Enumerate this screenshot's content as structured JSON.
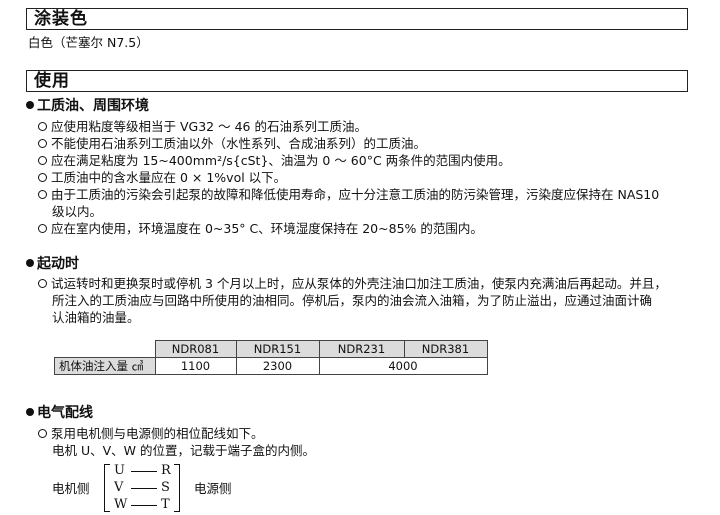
{
  "coating": {
    "heading": "涂装色",
    "text": "白色（芒塞尔 N7.5）"
  },
  "usage": {
    "heading": "使用",
    "oil": {
      "title": "工质油、周围环境",
      "lines": [
        "应使用粘度等级相当于 VG32 ～ 46 的石油系列工质油。",
        "不能使用石油系列工质油以外（水性系列、合成油系列）的工质油。",
        "应在满足粘度为 15~400mm²/s{cSt}、油温为 0 ～ 60°C 两条件的范围内使用。",
        "工质油中的含水量应在 0 × 1%vol 以下。",
        "由于工质油的污染会引起泵的故障和降低使用寿命，应十分注意工质油的防污染管理，污染度应保持在 NAS10",
        "级以内。",
        "应在室内使用，环境温度在 0~35° C、环境湿度保持在 20~85% 的范围内。"
      ]
    },
    "start": {
      "title": "起动时",
      "lines": [
        "试运转时和更换泵时或停机 3 个月以上时，应从泵体的外壳注油口加注工质油，使泵内充满油后再起动。并且，",
        "所注入的工质油应与回路中所使用的油相同。停机后，泵内的油会流入油箱，为了防止溢出，应通过油面计确",
        "认油箱的油量。"
      ]
    },
    "fill_table": {
      "header": [
        "NDR081",
        "NDR151",
        "NDR231",
        "NDR381"
      ],
      "row_label": "机体油注入量 ㎤",
      "values": [
        "1100",
        "2300",
        "4000"
      ]
    },
    "wiring": {
      "title": "电气配线",
      "lines": [
        "泵用电机侧与电源侧的相位配线如下。",
        "电机 U、V、W 的位置，记载于端子盒的内侧。"
      ],
      "motor_side": "电机侧",
      "power_side": "电源侧",
      "motor_terms": [
        "U",
        "V",
        "W"
      ],
      "power_terms": [
        "R",
        "S",
        "T"
      ]
    }
  }
}
